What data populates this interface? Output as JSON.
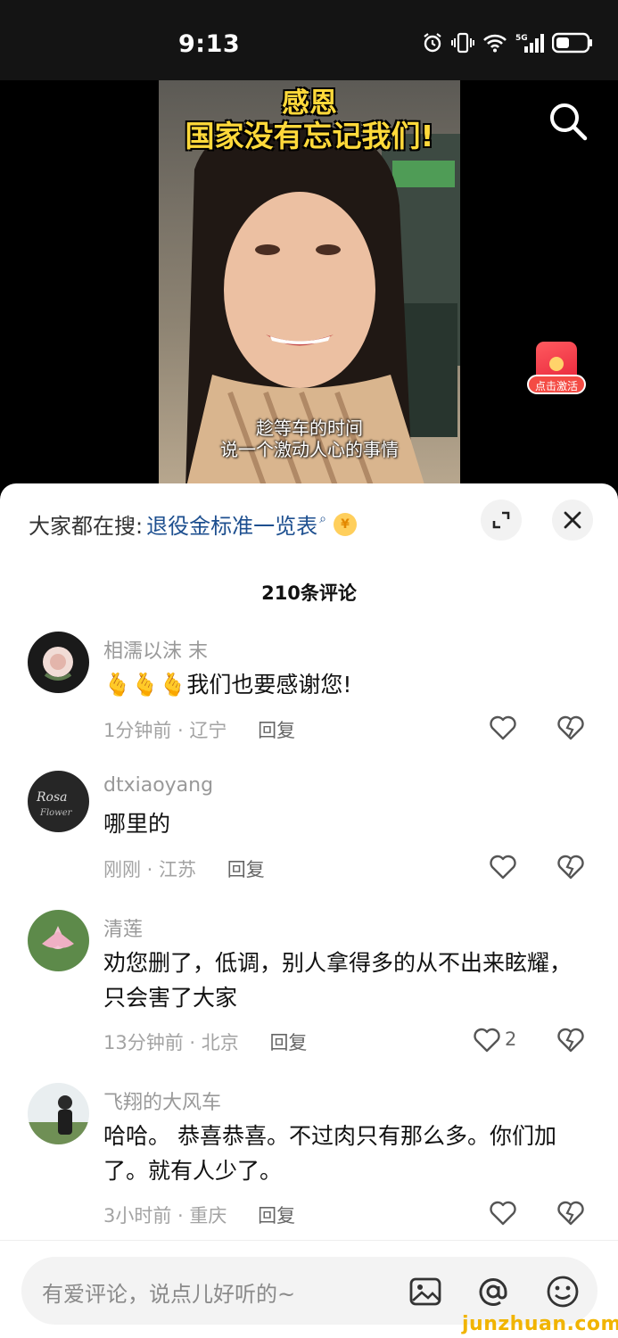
{
  "status": {
    "time": "9:13",
    "icons": [
      "alarm-icon",
      "vibrate-icon",
      "wifi-icon",
      "signal-5g-icon",
      "battery-icon"
    ]
  },
  "video": {
    "title_line1": "感恩",
    "title_line2": "国家没有忘记我们!",
    "subtitle_line1": "趁等车的时间",
    "subtitle_line2": "说一个激动人心的事情",
    "redpack_label": "点击激活"
  },
  "hot_search": {
    "prefix": "大家都在搜:",
    "query": "退役金标准一览表",
    "coin_symbol": "¥"
  },
  "comments_count": "210条评论",
  "comments": [
    {
      "username": "相濡以沫 末",
      "text": "🫰🫰🫰我们也要感谢您!",
      "meta": "1分钟前 · 辽宁",
      "reply": "回复",
      "likes": ""
    },
    {
      "username": "dtxiaoyang",
      "text": "哪里的",
      "meta": "刚刚 · 江苏",
      "reply": "回复",
      "likes": ""
    },
    {
      "username": "清莲",
      "text": "劝您删了，低调，别人拿得多的从不出来眩耀，只会害了大家",
      "meta": "13分钟前 · 北京",
      "reply": "回复",
      "likes": "2"
    },
    {
      "username": "飞翔的大风车",
      "text": "哈哈。 恭喜恭喜。不过肉只有那么多。你们加了。就有人少了。",
      "meta": "3小时前 · 重庆",
      "reply": "回复",
      "likes": ""
    }
  ],
  "input": {
    "placeholder": "有爱评论，说点儿好听的~"
  },
  "watermark": "junzhuan.com",
  "colors": {
    "accent_link": "#1d4f8f",
    "title_yellow": "#ffd93a",
    "redpack": "#f44b44"
  }
}
